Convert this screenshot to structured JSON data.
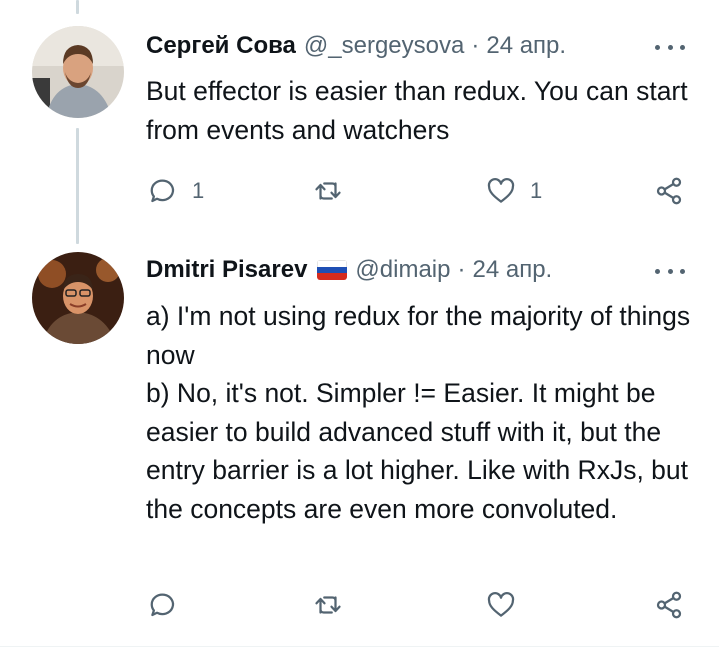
{
  "tweets": [
    {
      "name": "Сергей Сова",
      "handle": "@_sergeysova",
      "separator": "·",
      "date": "24 апр.",
      "text": "But effector is easier than redux. You can start from events and watchers",
      "actions": {
        "reply_count": "1",
        "retweet_count": "",
        "like_count": "1"
      }
    },
    {
      "name": "Dmitri Pisarev",
      "handle": "@dimaip",
      "separator": "·",
      "date": "24 апр.",
      "text": "a) I'm not using redux for the majority of things now\nb) No, it's not. Simpler != Easier. It might be easier to build advanced stuff with it, but the entry barrier is a lot higher. Like with RxJs, but the concepts are even more convoluted.",
      "actions": {
        "reply_count": "",
        "retweet_count": "",
        "like_count": ""
      }
    }
  ],
  "colors": {
    "text": "#0f1419",
    "secondary": "#536471",
    "thread_line": "#cfd9de"
  }
}
